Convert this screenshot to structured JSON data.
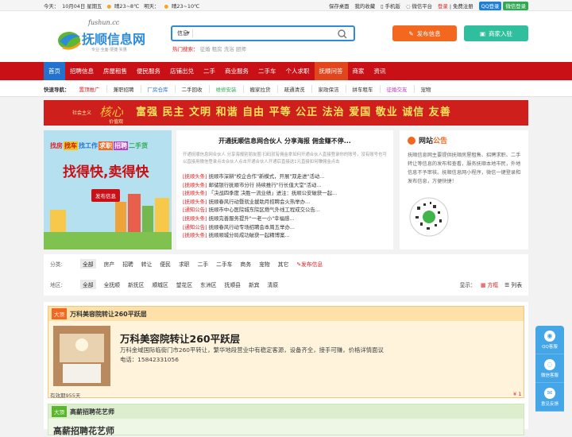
{
  "topbar": {
    "today_label": "今天：",
    "date": "10月04日 星期五",
    "weather1": "晴23~8℃",
    "tomorrow": "明天：",
    "weather2": "晴23~10℃",
    "links": [
      "保存桌面",
      "我的收藏",
      "手机版",
      "微信平台"
    ],
    "login": "登录",
    "register": "免费注册",
    "qq_login": "QQ登录",
    "wx_login": "微信登录"
  },
  "logo": {
    "domain": "fushun.cc",
    "name": "抚顺信息网",
    "slogan": "专业·全面·便捷·实惠"
  },
  "search": {
    "category": "信息",
    "placeholder": "",
    "hot_label": "热门搜索：",
    "hot_items": [
      "征婚",
      "租房",
      "洗浴",
      "厨师"
    ]
  },
  "header": {
    "publish": "发布信息",
    "join": "商家入驻"
  },
  "nav": {
    "items": [
      "首页",
      "招聘信息",
      "房屋租售",
      "便民服务",
      "店铺出兑",
      "二手",
      "商业服务",
      "二手车",
      "个人求职",
      "抚顺问答",
      "商家",
      "资讯"
    ]
  },
  "quick": {
    "label": "快速导航：",
    "items": [
      "置顶推广",
      "兼职招聘",
      "厂房仓库",
      "二手回收",
      "维修安装",
      "搬家拉货",
      "疏通清洗",
      "家政保洁",
      "拼车租车",
      "征婚交友",
      "宠物"
    ]
  },
  "banner": {
    "text": "富强 民主 文明 和谐 自由 平等 公正 法治 爱国 敬业 诚信 友善",
    "prefix": "社会主义",
    "core": "核心",
    "suffix": "价值观"
  },
  "ad": {
    "tags": [
      "找房",
      "找车",
      "找工作",
      "求职",
      "招聘",
      "二手货"
    ],
    "headline": "找得快,卖得快",
    "cta": "发布信息"
  },
  "news": {
    "title": "开通抚顺信息网合伙人 分享海报 佣金赚不停...",
    "intro": "开通抚顺信息网合伙人 分享海报别朋友圈 扫码就有佣金拿如何开通合伙人直接登录你的账号，没有账号也可以直接用微信登录点击合伙人点击开通合伙人开通后直接送1元直接如何赚佣金点击",
    "items": [
      {
        "tag": "[抚顺头条]",
        "text": "抚顺市深耕\"校企合作\"新模式，开展\"双走进\"活动..."
      },
      {
        "tag": "[抚顺头条]",
        "text": "邮储银行抚顺市分行 持续推行\"行长值大堂\"活动..."
      },
      {
        "tag": "[抚顺头条]",
        "text": "「决战四季度 决胜一流业绩」进注：抚顺公安破获一起..."
      },
      {
        "tag": "[抚顺头条]",
        "text": "抚顺春风行动暨就业援助月招聘会火热举办..."
      },
      {
        "tag": "[通知公告]",
        "text": "抚顺市中心医院城东院区燃气外线工程成交公告..."
      },
      {
        "tag": "[抚顺头条]",
        "text": "抚顺完善服务提升\"一老一小\"幸福感..."
      },
      {
        "tag": "[通知公告]",
        "text": "抚顺春风行动专场招聘会本周五举办..."
      },
      {
        "tag": "[抚顺头条]",
        "text": "抚顺顺城分局成功破获一起精博案..."
      }
    ]
  },
  "notice": {
    "title_a": "网站",
    "title_b": "公告",
    "text": "抚顺信息网主要提供抚顺房屋租售、招聘求职、二手转让等信息的发布和查看，服务抚顺本地市民，外地信息不予审核。抚顺信息网小程序，微信一键登录和发布信息，方便快捷！"
  },
  "filter": {
    "cat_label": "分类:",
    "cats": [
      "全部",
      "房产",
      "招聘",
      "转让",
      "便民",
      "求职",
      "二手",
      "二手车",
      "商务",
      "宠物",
      "其它"
    ],
    "publish": "发布信息",
    "area_label": "地区:",
    "areas": [
      "全部",
      "全抚顺",
      "新抚区",
      "顺城区",
      "望花区",
      "东洲区",
      "抚顺县",
      "新宾",
      "清原"
    ],
    "display_label": "显示：",
    "view_grid": "方框",
    "view_list": "列表"
  },
  "listing": {
    "badge": "大顶",
    "title": "万科美容院转让260平跃层",
    "big_title": "万科美容院转让260平跃层",
    "desc": "万科金域国际临街门市260平转让，繁华地段营业中有稳定客源，设备齐全，接手可赚，价格详情面议",
    "phone": "电话：15842331056",
    "valid": "有效期955天",
    "price": "¥ 1"
  },
  "listing2": {
    "badge": "大顶",
    "title": "高薪招聘花艺师",
    "big_title": "高薪招聘花艺师"
  },
  "float": {
    "items": [
      "QQ客服",
      "微信客服",
      "意见反馈"
    ]
  },
  "colors": {
    "nav": "#c81016",
    "accent": "#f3671e",
    "blue": "#2e8bd8",
    "teal": "#2fbf9e"
  }
}
